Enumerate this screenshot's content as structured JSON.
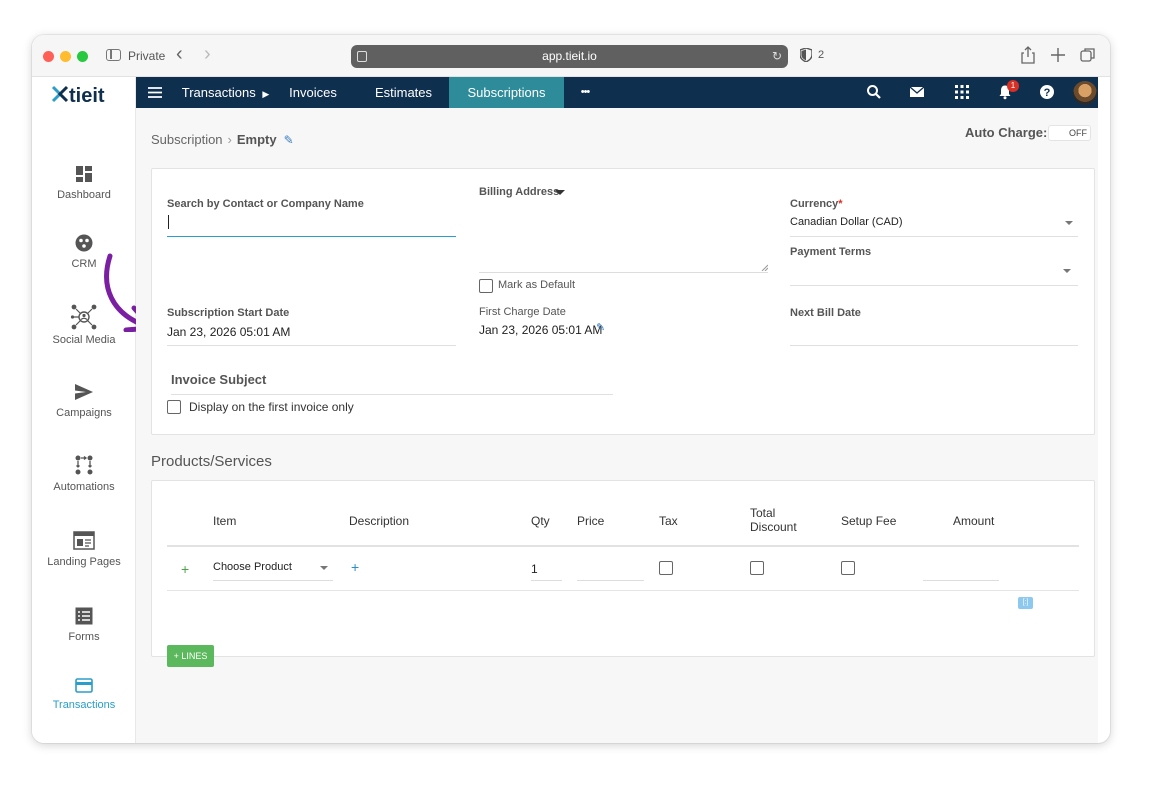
{
  "browser": {
    "private_label": "Private",
    "url": "app.tieit.io",
    "shield_count": "2"
  },
  "sidebar": {
    "logo_text": "tieit",
    "items": [
      {
        "label": "Dashboard",
        "icon": "dashboard-icon"
      },
      {
        "label": "CRM",
        "icon": "crm-icon"
      },
      {
        "label": "Social Media",
        "icon": "social-media-icon"
      },
      {
        "label": "Campaigns",
        "icon": "send-icon"
      },
      {
        "label": "Automations",
        "icon": "automation-icon"
      },
      {
        "label": "Landing Pages",
        "icon": "landing-page-icon"
      },
      {
        "label": "Forms",
        "icon": "form-icon"
      },
      {
        "label": "Transactions",
        "icon": "card-icon",
        "active": true
      }
    ]
  },
  "topnav": {
    "tabs": [
      {
        "label": "Transactions"
      },
      {
        "label": "Invoices"
      },
      {
        "label": "Estimates"
      },
      {
        "label": "Subscriptions",
        "active": true
      }
    ],
    "more": "•••",
    "notification_count": "1"
  },
  "header": {
    "breadcrumb_root": "Subscription",
    "breadcrumb_sep": "›",
    "breadcrumb_current": "Empty",
    "auto_charge_label": "Auto Charge:",
    "auto_charge_state": "OFF"
  },
  "form": {
    "search_label": "Search by Contact or Company Name",
    "search_value": "",
    "billing_address_label": "Billing Address",
    "mark_default_label": "Mark as Default",
    "currency_label": "Currency",
    "currency_required": "*",
    "currency_value": "Canadian Dollar (CAD)",
    "payment_terms_label": "Payment Terms",
    "start_date_label": "Subscription Start Date",
    "start_date_value": "Jan 23, 2026 05:01 AM",
    "first_charge_label": "First Charge Date",
    "first_charge_value": "Jan 23, 2026 05:01 AM",
    "next_bill_label": "Next Bill Date",
    "invoice_subject_label": "Invoice Subject",
    "first_invoice_only_label": "Display on the first invoice only"
  },
  "products": {
    "section_title": "Products/Services",
    "columns": {
      "item": "Item",
      "description": "Description",
      "qty": "Qty",
      "price": "Price",
      "tax": "Tax",
      "total_discount": "Total Discount",
      "setup_fee": "Setup Fee",
      "amount": "Amount"
    },
    "row": {
      "item": "Choose Product",
      "qty": "1"
    },
    "lines_button": "+ LINES"
  },
  "colors": {
    "nav_bg": "#0f2f4f",
    "active_tab": "#2e8b99",
    "accent": "#2a9dc9",
    "lines_button": "#5cb85c",
    "arrow": "#7b1fa2"
  }
}
